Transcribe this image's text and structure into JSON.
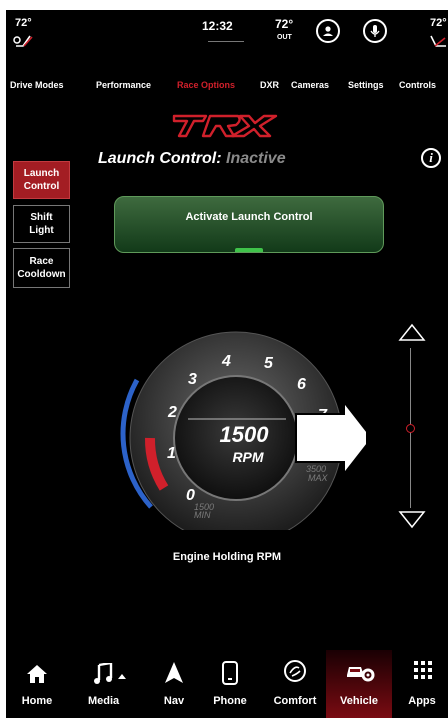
{
  "status": {
    "left_temp": "72°",
    "time": "12:32",
    "outside_temp": "72°",
    "outside_label": "OUT",
    "right_temp": "72°"
  },
  "tabs": [
    {
      "label": "Drive Modes",
      "active": false
    },
    {
      "label": "Performance",
      "active": false
    },
    {
      "label": "Race Options",
      "active": true
    },
    {
      "label": "DXR",
      "active": false
    },
    {
      "label": "Cameras",
      "active": false
    },
    {
      "label": "Settings",
      "active": false
    },
    {
      "label": "Controls",
      "active": false
    }
  ],
  "brand": {
    "logo_text": "TRX",
    "accent": "#d0202b"
  },
  "launch": {
    "title": "Launch Control:",
    "state": "Inactive",
    "info_icon": "info-icon"
  },
  "sidebar": {
    "items": [
      {
        "label": "Launch Control",
        "active": true
      },
      {
        "label": "Shift Light",
        "active": false
      },
      {
        "label": "Race Cooldown",
        "active": false
      }
    ]
  },
  "activate_button": {
    "label": "Activate Launch Control"
  },
  "gauge": {
    "rpm_value": "1500",
    "rpm_unit": "RPM",
    "ticks": [
      "0",
      "1",
      "2",
      "3",
      "4",
      "5",
      "6",
      "7"
    ],
    "min_value": "1500",
    "min_label": "MIN",
    "max_value": "3500",
    "max_label": "MAX",
    "colors": {
      "red": "#d0202b",
      "blue": "#2c62c9"
    }
  },
  "engine_holding_label": "Engine Holding RPM",
  "slider": {
    "up_icon": "triangle-up-icon",
    "down_icon": "triangle-down-icon",
    "level": 0.5
  },
  "nav": [
    {
      "label": "Home",
      "icon": "home-icon",
      "active": false
    },
    {
      "label": "Media",
      "icon": "music-note-icon",
      "active": false
    },
    {
      "label": "Nav",
      "icon": "navigation-arrow-icon",
      "active": false
    },
    {
      "label": "Phone",
      "icon": "phone-icon",
      "active": false
    },
    {
      "label": "Comfort",
      "icon": "comfort-icon",
      "active": false
    },
    {
      "label": "Vehicle",
      "icon": "vehicle-settings-icon",
      "active": true
    },
    {
      "label": "Apps",
      "icon": "apps-grid-icon",
      "active": false
    }
  ]
}
